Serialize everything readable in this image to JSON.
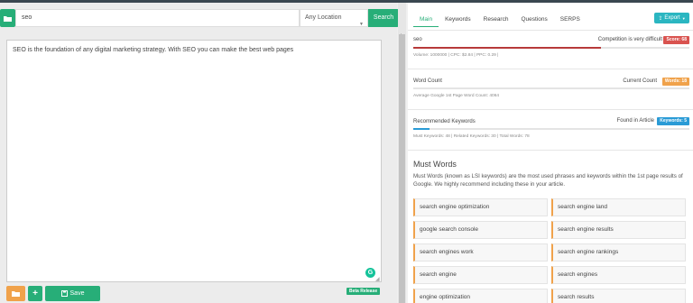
{
  "search": {
    "value": "seo",
    "location": "Any Location",
    "button": "Search"
  },
  "editor": {
    "text": "SEO is the foundation of any digital marketing strategy. With SEO you can make the best web pages"
  },
  "footer": {
    "save_label": "Save",
    "beta_label": "Beta Release"
  },
  "tabs": [
    {
      "label": "Main"
    },
    {
      "label": "Keywords"
    },
    {
      "label": "Research"
    },
    {
      "label": "Questions"
    },
    {
      "label": "SERPS"
    }
  ],
  "export": {
    "label": "Export"
  },
  "keyword_metric": {
    "keyword": "seo",
    "competition": "Competition is very difficult",
    "score": "Score: 68",
    "score_value": 68,
    "details": "Volume: 1000000 | CPC: $2.84 | PPC: 0.29 |"
  },
  "word_count": {
    "label": "Word Count",
    "current": "Current Count",
    "badge": "Words: 18",
    "details": "Average Google 1st Page Word Count: 4064"
  },
  "recommended": {
    "label": "Recommended Keywords",
    "found": "Found in Article",
    "badge": "Keywords: 5",
    "details": "Must Keywords: 48 | Related Keywords: 30 | Total Words: 78"
  },
  "must_words": {
    "title": "Must Words",
    "description": "Must Words (known as LSI keywords) are the most used phrases and keywords within the 1st page results of Google. We highly recommend including these in your article.",
    "items": [
      "search engine optimization",
      "search engine land",
      "google search console",
      "search engine results",
      "search engines work",
      "search engine rankings",
      "search engine",
      "search engines",
      "engine optimization",
      "search results"
    ]
  },
  "colors": {
    "green": "#27ae78",
    "red": "#d9534f",
    "orange": "#f0a24b",
    "blue": "#2a9bd6",
    "teal": "#2bb6c1"
  }
}
